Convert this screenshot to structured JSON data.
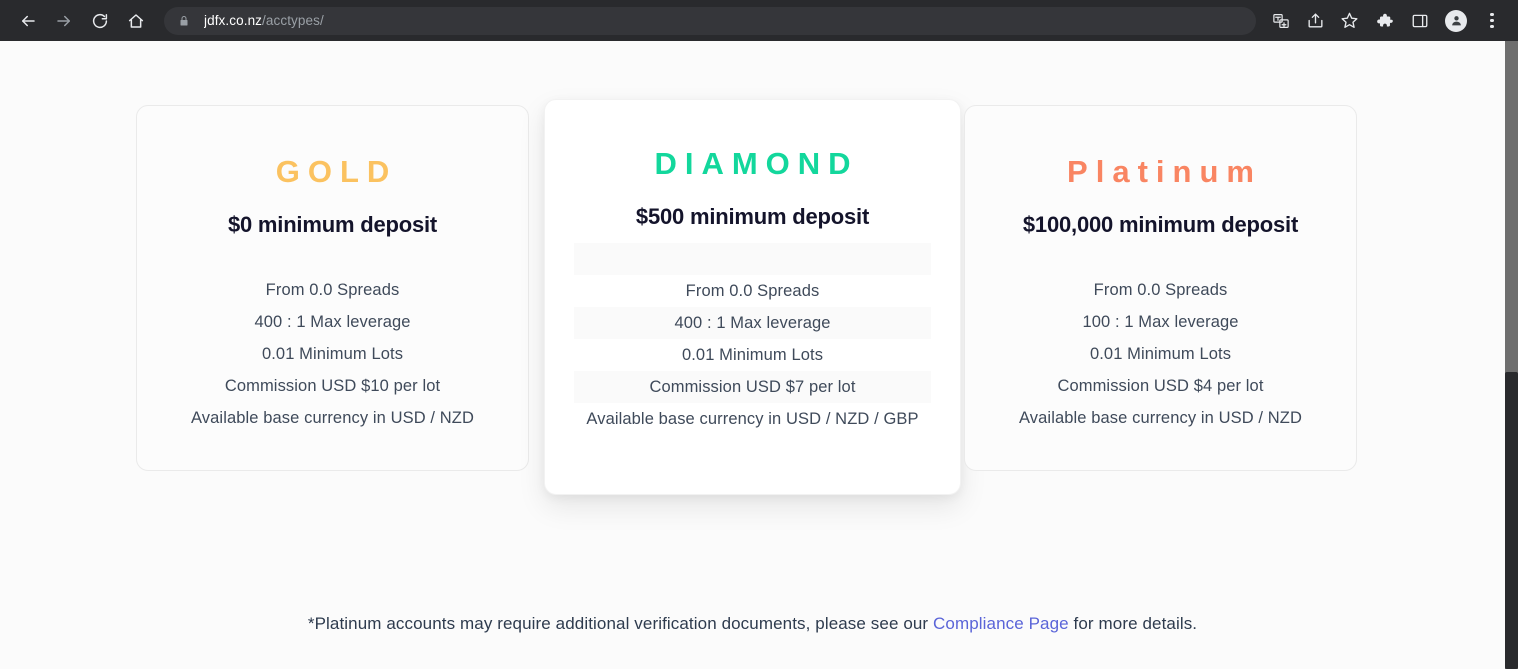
{
  "browser": {
    "nav": {
      "back": "back-arrow",
      "forward": "forward-arrow",
      "reload": "reload",
      "home": "home"
    },
    "omnibox": {
      "lock_icon": "lock-icon",
      "url_domain": "jdfx.co.nz",
      "url_path": "/acctypes/",
      "full_url": "jdfx.co.nz/acctypes/"
    },
    "toolbar_icons": [
      {
        "name": "translate-icon",
        "glyph": "translate"
      },
      {
        "name": "share-icon",
        "glyph": "share"
      },
      {
        "name": "bookmark-star-icon",
        "glyph": "star"
      },
      {
        "name": "extensions-puzzle-icon",
        "glyph": "puzzle"
      },
      {
        "name": "side-panel-icon",
        "glyph": "panel"
      },
      {
        "name": "profile-avatar-icon",
        "glyph": "avatar"
      },
      {
        "name": "chrome-menu-icon",
        "glyph": "kebab"
      }
    ]
  },
  "page": {
    "cards": [
      {
        "tier": "GOLD",
        "deposit": "$0 minimum deposit",
        "features": [
          "From 0.0 Spreads",
          "400 : 1  Max leverage",
          "0.01 Minimum Lots",
          "Commission USD $10 per lot",
          "Available base currency in USD / NZD"
        ],
        "accent_color": "#fbc260",
        "featured": false
      },
      {
        "tier": "DIAMOND",
        "deposit": "$500 minimum deposit",
        "features": [
          "From 0.0 Spreads",
          "400 : 1  Max leverage",
          "0.01 Minimum Lots",
          "Commission USD $7 per lot",
          "Available base currency in USD / NZD / GBP"
        ],
        "accent_color": "#13d79c",
        "featured": true
      },
      {
        "tier": "Platinum",
        "deposit": "$100,000 minimum deposit",
        "features": [
          "From 0.0 Spreads",
          "100 : 1  Max leverage",
          "0.01 Minimum Lots",
          "Commission USD $4 per lot",
          "Available base currency in USD / NZD"
        ],
        "accent_color": "#f98562",
        "featured": false
      }
    ],
    "footnote": {
      "before_link": "*Platinum accounts may require additional verification documents, please see our ",
      "link_text": "Compliance Page",
      "after_link": " for more details.",
      "link_color": "#5a64d8"
    }
  }
}
